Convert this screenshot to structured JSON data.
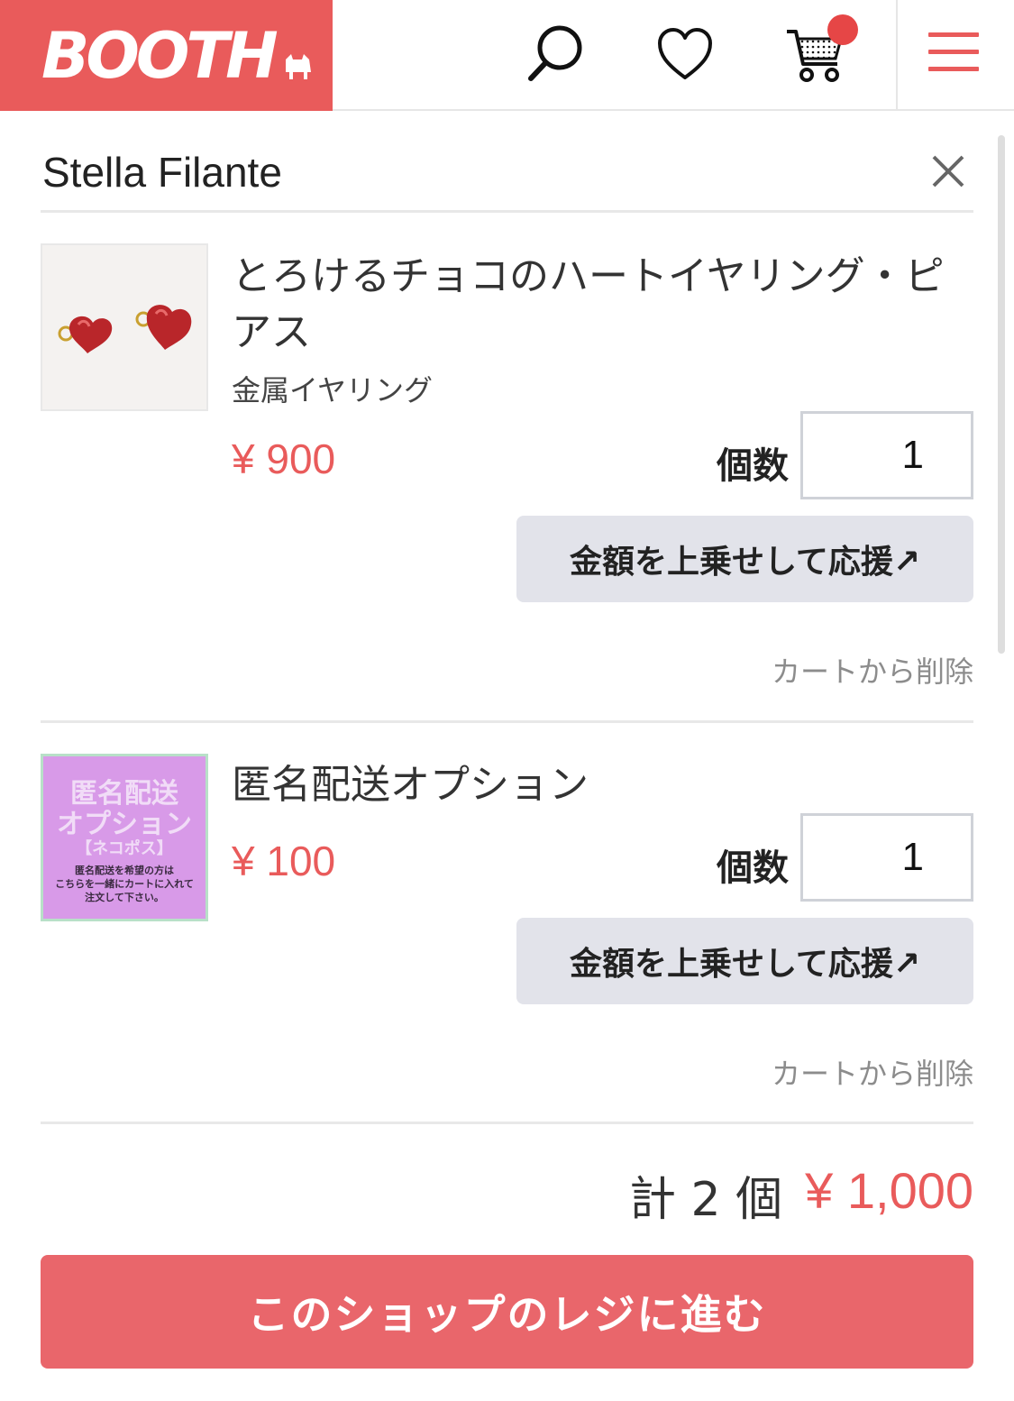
{
  "header": {
    "logo_text": "BOOTH",
    "cart_has_badge": true,
    "icons": [
      "search-icon",
      "heart-icon",
      "cart-icon",
      "menu-icon"
    ]
  },
  "shop": {
    "name": "Stella Filante"
  },
  "items": [
    {
      "title": "とろけるチョコのハートイヤリング・ピアス",
      "title_line1": "とろけるチョコのハートイヤリング・ピ",
      "title_line2": "アス",
      "variant": "金属イヤリング",
      "price": "¥ 900",
      "qty_label": "個数",
      "qty": "1",
      "support_label": "金額を上乗せして応援↗",
      "remove_label": "カートから削除"
    },
    {
      "title": "匿名配送オプション",
      "thumb_text": {
        "line1": "匿名配送",
        "line2": "オプション",
        "line3": "【ネコポス】",
        "line4": "匿名配送を希望の方は",
        "line5": "こちらを一緒にカートに入れて",
        "line6": "注文して下さい。"
      },
      "price": "¥ 100",
      "qty_label": "個数",
      "qty": "1",
      "support_label": "金額を上乗せして応援↗",
      "remove_label": "カートから削除"
    }
  ],
  "summary": {
    "count_label": "計 2 個",
    "total": "¥ 1,000"
  },
  "checkout_label": "このショップのレジに進む",
  "colors": {
    "brand": "#e95b5b",
    "checkout": "#e9666b",
    "price": "#e95b5b"
  }
}
